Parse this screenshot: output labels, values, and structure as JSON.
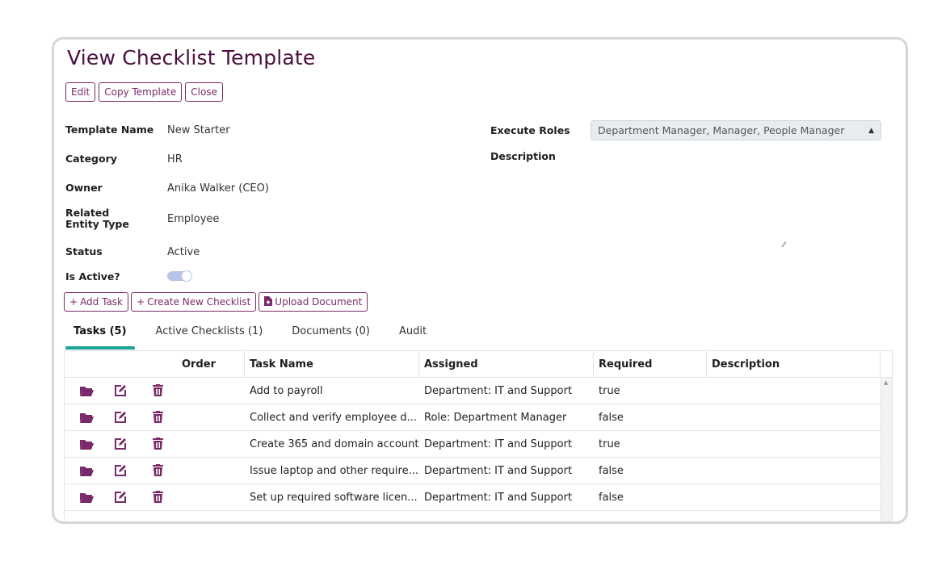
{
  "page": {
    "title": "View Checklist Template"
  },
  "toolbar": {
    "edit": "Edit",
    "copy_template": "Copy Template",
    "close": "Close"
  },
  "fields": {
    "template_name": {
      "label": "Template Name",
      "value": "New Starter"
    },
    "category": {
      "label": "Category",
      "value": "HR"
    },
    "owner": {
      "label": "Owner",
      "value": "Anika Walker (CEO)"
    },
    "related_entity_type": {
      "label": "Related Entity Type",
      "value": "Employee"
    },
    "status": {
      "label": "Status",
      "value": "Active"
    },
    "is_active": {
      "label": "Is Active?",
      "value": true
    },
    "execute_roles": {
      "label": "Execute Roles",
      "value": "Department Manager, Manager, People Manager"
    },
    "description": {
      "label": "Description",
      "value": ""
    }
  },
  "actions": {
    "add_task": "Add Task",
    "create_new_checklist": "Create New Checklist",
    "upload_document": "Upload Document"
  },
  "tabs": [
    {
      "label": "Tasks (5)",
      "active": true
    },
    {
      "label": "Active Checklists (1)",
      "active": false
    },
    {
      "label": "Documents (0)",
      "active": false
    },
    {
      "label": "Audit",
      "active": false
    }
  ],
  "grid": {
    "columns": [
      "Order",
      "Task Name",
      "Assigned",
      "Required",
      "Description"
    ],
    "rows": [
      {
        "order": "",
        "task_name": "Add to payroll",
        "assigned": "Department: IT and Support",
        "required": "true",
        "description": ""
      },
      {
        "order": "",
        "task_name": "Collect and verify employee d...",
        "assigned": "Role: Department Manager",
        "required": "false",
        "description": ""
      },
      {
        "order": "",
        "task_name": "Create 365 and domain account",
        "assigned": "Department: IT and Support",
        "required": "true",
        "description": ""
      },
      {
        "order": "",
        "task_name": "Issue laptop and other require...",
        "assigned": "Department: IT and Support",
        "required": "false",
        "description": ""
      },
      {
        "order": "",
        "task_name": "Set up required software licen...",
        "assigned": "Department: IT and Support",
        "required": "false",
        "description": ""
      }
    ]
  },
  "colors": {
    "accent": "#7a2a68",
    "title": "#4b0f3e",
    "tab_indicator": "#1aa596",
    "toggle": "#b7c3ea"
  },
  "icons": [
    "folder-open-icon",
    "edit-icon",
    "trash-icon",
    "file-upload-icon",
    "plus-icon",
    "select-arrows-icon",
    "resize-handle-icon"
  ]
}
